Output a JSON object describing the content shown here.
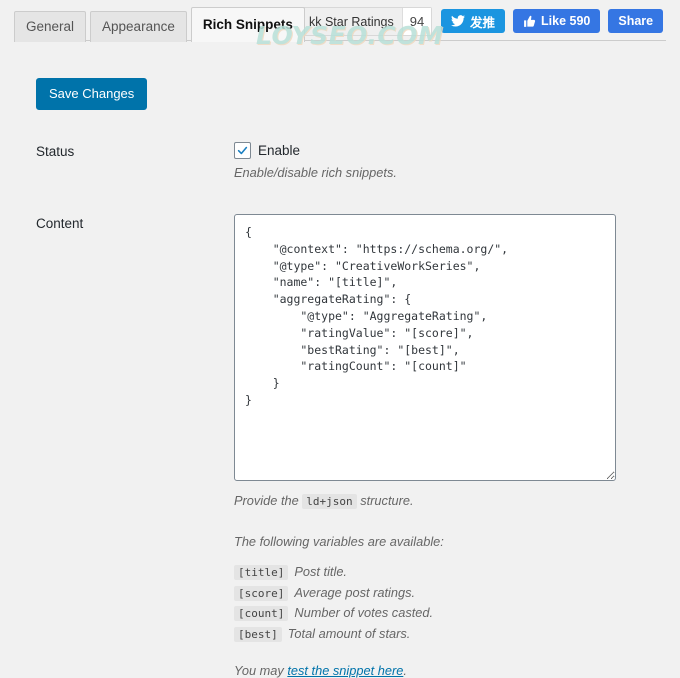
{
  "tabs": [
    {
      "label": "General",
      "active": false
    },
    {
      "label": "Appearance",
      "active": false
    },
    {
      "label": "Rich Snippets",
      "active": true
    }
  ],
  "kk_widget": {
    "icon": "star-outline-icon",
    "label": "kk Star Ratings",
    "count": "94"
  },
  "social": [
    {
      "name": "twitter",
      "icon": "twitter-bird-icon",
      "label": "发推",
      "color": "#1b95e0"
    },
    {
      "name": "facebook-like",
      "icon": "thumbs-up-icon",
      "label": "Like 590",
      "color": "#3b5998"
    },
    {
      "name": "facebook-share",
      "icon": "",
      "label": "Share",
      "color": "#3b5998"
    }
  ],
  "watermark": "LOYSEO.COM",
  "toolbar": {
    "save_label": "Save Changes"
  },
  "fields": {
    "status": {
      "label": "Status",
      "checkbox_label": "Enable",
      "checked": true,
      "description": "Enable/disable rich snippets."
    },
    "content": {
      "label": "Content",
      "value": "{\n    \"@context\": \"https://schema.org/\",\n    \"@type\": \"CreativeWorkSeries\",\n    \"name\": \"[title]\",\n    \"aggregateRating\": {\n        \"@type\": \"AggregateRating\",\n        \"ratingValue\": \"[score]\",\n        \"bestRating\": \"[best]\",\n        \"ratingCount\": \"[count]\"\n    }\n}",
      "provide_prefix": "Provide the",
      "provide_code": "ld+json",
      "provide_suffix": "structure.",
      "available_intro": "The following variables are available:",
      "variables": [
        {
          "token": "[title]",
          "desc": "Post title."
        },
        {
          "token": "[score]",
          "desc": "Average post ratings."
        },
        {
          "token": "[count]",
          "desc": "Number of votes casted."
        },
        {
          "token": "[best]",
          "desc": "Total amount of stars."
        }
      ],
      "footer_prefix": "You may",
      "footer_link": "test the snippet here",
      "footer_suffix": "."
    }
  },
  "colors": {
    "accent": "#0073aa",
    "twitter": "#1b95e0",
    "facebook": "#3b5998",
    "page_bg": "#f1f1f1",
    "watermark": "#b8e0d8"
  }
}
